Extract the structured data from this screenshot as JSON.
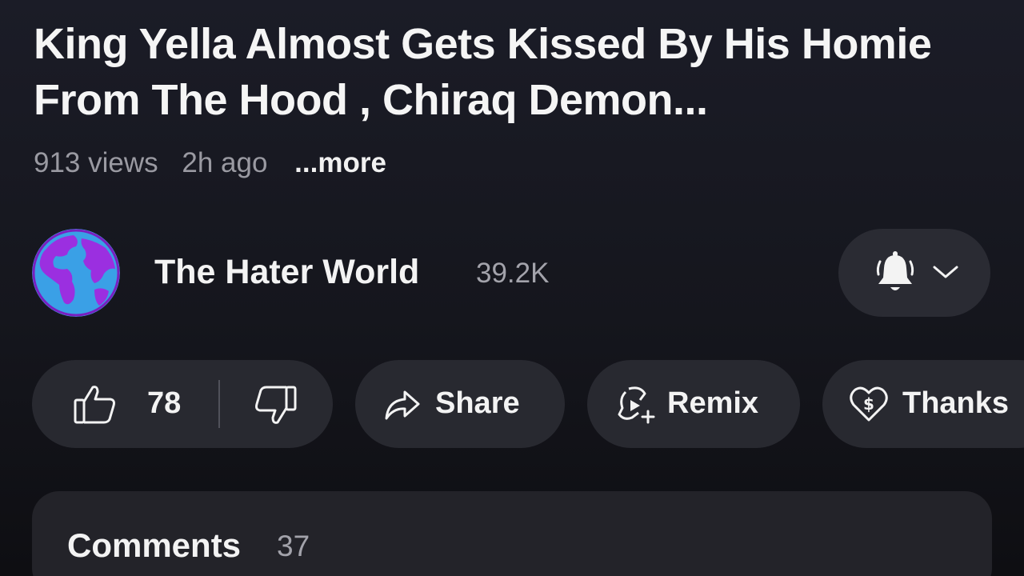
{
  "video": {
    "title": "King Yella Almost Gets Kissed By His Homie From The Hood , Chiraq Demon...",
    "views": "913 views",
    "age": "2h ago",
    "more_label": "...more"
  },
  "channel": {
    "name": "The Hater World",
    "subscribers": "39.2K",
    "avatar_icon": "globe-avatar",
    "notify_icon": "bell-icon"
  },
  "actions": {
    "likes": "78",
    "share_label": "Share",
    "remix_label": "Remix",
    "thanks_label": "Thanks"
  },
  "comments": {
    "label": "Comments",
    "count": "37"
  },
  "colors": {
    "background": "#1b1c27",
    "pill": "#282930",
    "avatar_ocean": "#8a2be2",
    "avatar_land": "#3aa0e6"
  }
}
